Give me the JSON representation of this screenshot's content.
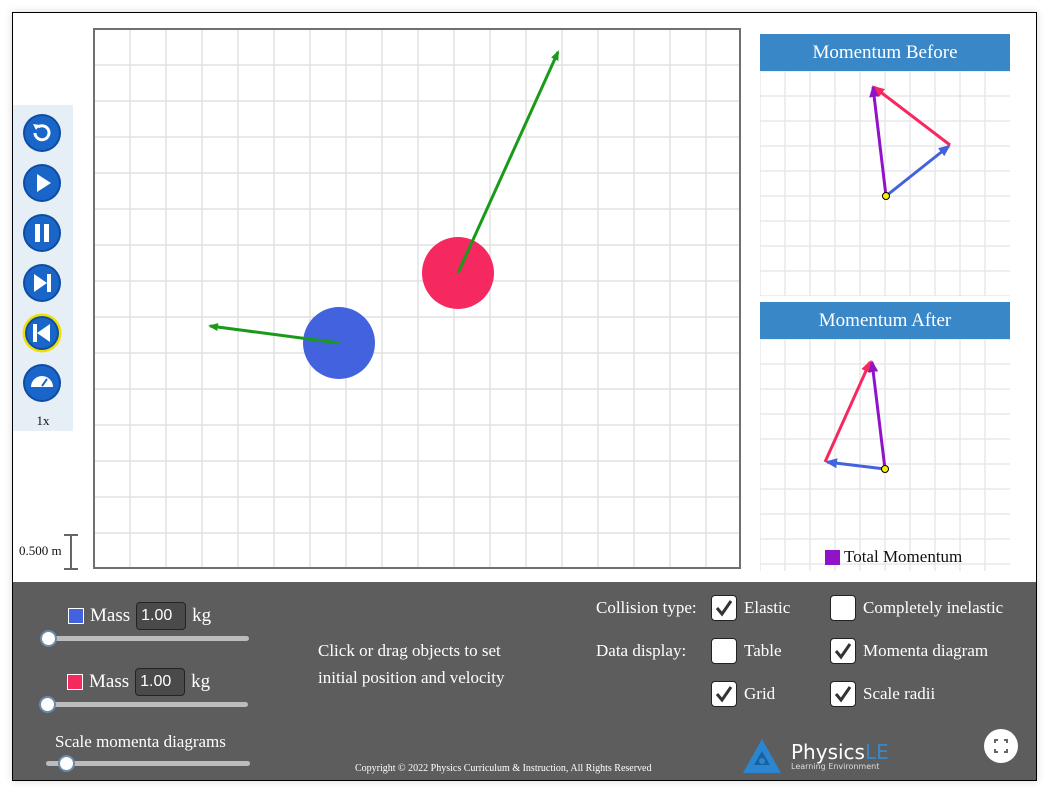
{
  "simulation": {
    "speed_label": "1x",
    "scale_label": "0.500 m",
    "grid_visible": true,
    "objects": [
      {
        "name": "blue",
        "color": "#4262de"
      },
      {
        "name": "red",
        "color": "#f5285f"
      }
    ],
    "velocity_arrow_color": "#1a9a1a"
  },
  "controls": {
    "buttons": [
      {
        "name": "reset",
        "icon": "reset-icon"
      },
      {
        "name": "play",
        "icon": "play-icon"
      },
      {
        "name": "pause",
        "icon": "pause-icon"
      },
      {
        "name": "step-forward",
        "icon": "step-forward-icon"
      },
      {
        "name": "step-back",
        "icon": "step-back-icon",
        "highlighted": true
      },
      {
        "name": "speed",
        "icon": "speedometer-icon"
      }
    ]
  },
  "diagrams": {
    "before_title": "Momentum Before",
    "after_title": "Momentum After",
    "legend_label": "Total Momentum",
    "colors": {
      "blue": "#4262de",
      "red": "#f5285f",
      "total": "#9013c8",
      "origin": "#ffee00"
    }
  },
  "panel": {
    "mass1": {
      "label": "Mass",
      "value": "1.00",
      "unit": "kg",
      "color": "#4262de",
      "slider_fraction": 0.0
    },
    "mass2": {
      "label": "Mass",
      "value": "1.00",
      "unit": "kg",
      "color": "#f5285f",
      "slider_fraction": 0.0
    },
    "scale_label": "Scale momenta diagrams",
    "scale_slider_fraction": 0.1,
    "instructions_line1": "Click or drag objects to set",
    "instructions_line2": "initial position and velocity",
    "collision_type_label": "Collision type:",
    "data_display_label": "Data display:",
    "options": {
      "elastic": {
        "label": "Elastic",
        "checked": true
      },
      "inelastic": {
        "label": "Completely inelastic",
        "checked": false
      },
      "table": {
        "label": "Table",
        "checked": false
      },
      "momenta": {
        "label": "Momenta diagram",
        "checked": true
      },
      "grid": {
        "label": "Grid",
        "checked": true
      },
      "scale_radii": {
        "label": "Scale radii",
        "checked": true
      }
    },
    "copyright": "Copyright © 2022 Physics Curriculum & Instruction, All Rights Reserved",
    "logo_main": "Physics",
    "logo_accent": "LE",
    "logo_sub": "Learning Environment"
  }
}
